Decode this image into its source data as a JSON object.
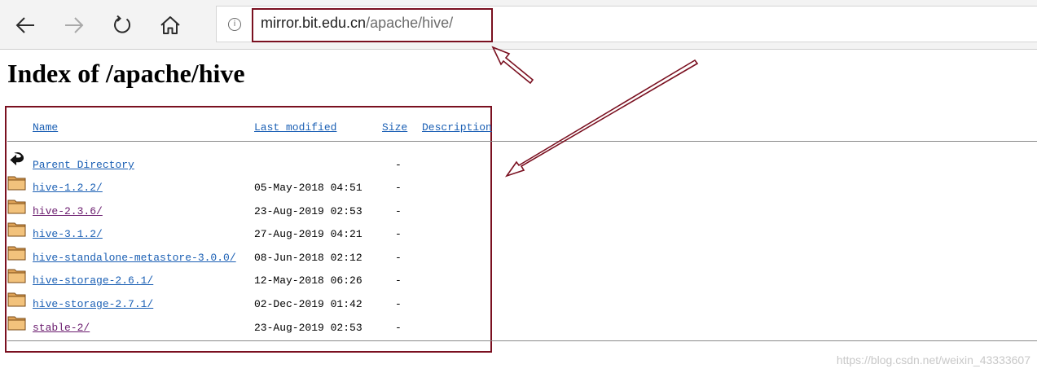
{
  "browser": {
    "url_domain": "mirror.bit.edu.cn",
    "url_path": "/apache/hive/",
    "info_icon_glyph": "i",
    "icons": [
      "back-arrow-icon",
      "forward-arrow-icon",
      "refresh-icon",
      "home-icon",
      "info-icon"
    ]
  },
  "page": {
    "title": "Index of /apache/hive",
    "columns": {
      "name": "Name",
      "last_modified": "Last modified",
      "size": "Size",
      "description": "Description"
    },
    "parent": {
      "name": "Parent Directory",
      "size": "-",
      "icon": "back-icon"
    },
    "rows": [
      {
        "name": "hive-1.2.2/",
        "date": "05-May-2018 04:51",
        "size": "-",
        "visited": false,
        "icon": "folder-icon"
      },
      {
        "name": "hive-2.3.6/",
        "date": "23-Aug-2019 02:53",
        "size": "-",
        "visited": true,
        "icon": "folder-icon"
      },
      {
        "name": "hive-3.1.2/",
        "date": "27-Aug-2019 04:21",
        "size": "-",
        "visited": false,
        "icon": "folder-icon"
      },
      {
        "name": "hive-standalone-metastore-3.0.0/",
        "date": "08-Jun-2018 02:12",
        "size": "-",
        "visited": false,
        "icon": "folder-icon"
      },
      {
        "name": "hive-storage-2.6.1/",
        "date": "12-May-2018 06:26",
        "size": "-",
        "visited": false,
        "icon": "folder-icon"
      },
      {
        "name": "hive-storage-2.7.1/",
        "date": "02-Dec-2019 01:42",
        "size": "-",
        "visited": false,
        "icon": "folder-icon"
      },
      {
        "name": "stable-2/",
        "date": "23-Aug-2019 02:53",
        "size": "-",
        "visited": true,
        "icon": "folder-icon"
      }
    ]
  },
  "watermark": "https://blog.csdn.net/weixin_43333607",
  "colors": {
    "annotation": "#7a1020",
    "link": "#1a5fb4",
    "visited_link": "#6a1b6e"
  }
}
